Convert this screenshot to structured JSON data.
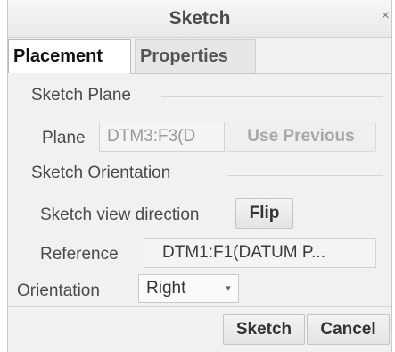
{
  "window": {
    "title": "Sketch",
    "close_glyph": "×"
  },
  "tabs": [
    {
      "label": "Placement",
      "active": true
    },
    {
      "label": "Properties",
      "active": false
    }
  ],
  "sketch_plane": {
    "section_title": "Sketch Plane",
    "plane_label": "Plane",
    "plane_value": "DTM3:F3(D",
    "use_previous_label": "Use Previous"
  },
  "sketch_orientation": {
    "section_title": "Sketch Orientation",
    "view_direction_label": "Sketch view direction",
    "flip_label": "Flip",
    "reference_label": "Reference",
    "reference_value": "DTM1:F1(DATUM P...",
    "orientation_label": "Orientation",
    "orientation_value": "Right"
  },
  "footer": {
    "sketch_label": "Sketch",
    "cancel_label": "Cancel"
  },
  "icons": {
    "close": "close-icon",
    "dropdown": "chevron-down-icon"
  }
}
